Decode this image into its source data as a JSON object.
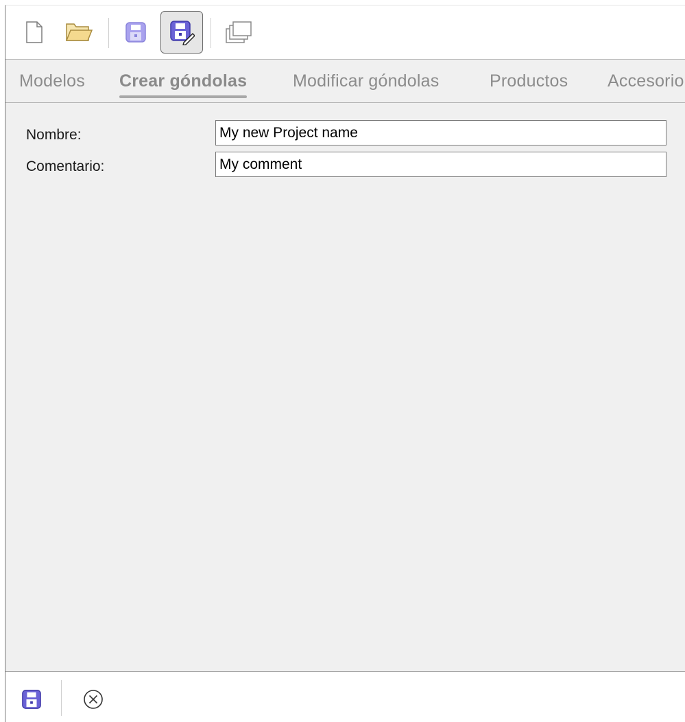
{
  "toolbar": {
    "buttons": [
      {
        "icon": "new-document-icon"
      },
      {
        "icon": "open-folder-icon"
      },
      {
        "icon": "save-icon"
      },
      {
        "icon": "save-edit-icon",
        "active": true
      },
      {
        "icon": "duplicate-icon"
      }
    ]
  },
  "tabs": [
    {
      "label": "Modelos",
      "active": false
    },
    {
      "label": "Crear góndolas",
      "active": true
    },
    {
      "label": "Modificar góndolas",
      "active": false
    },
    {
      "label": "Productos",
      "active": false
    },
    {
      "label": "Accesorio",
      "active": false
    }
  ],
  "form": {
    "name_label": "Nombre:",
    "name_value": "My new Project name",
    "comment_label": "Comentario:",
    "comment_value": "My comment"
  },
  "bottom": {
    "buttons": [
      {
        "icon": "save-icon"
      },
      {
        "icon": "cancel-icon"
      }
    ]
  },
  "colors": {
    "accent": "#6b63d6",
    "accent_light": "#a9a2ee",
    "folder": "#f4d98e"
  }
}
